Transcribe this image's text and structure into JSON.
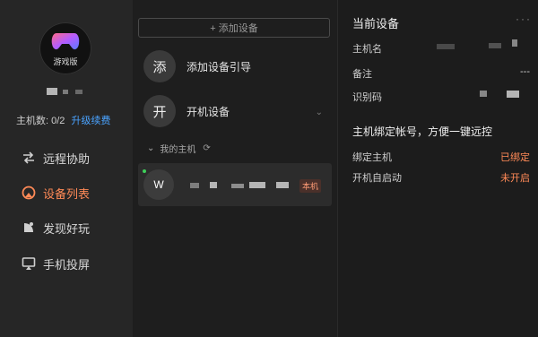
{
  "sidebar": {
    "avatar_label": "游戏版",
    "host_count_label": "主机数: 0/2",
    "upgrade_label": "升级续费",
    "items": [
      {
        "label": "远程协助",
        "icon": "arrows-swap-icon"
      },
      {
        "label": "设备列表",
        "icon": "device-list-icon"
      },
      {
        "label": "发现好玩",
        "icon": "discover-icon"
      },
      {
        "label": "手机投屏",
        "icon": "screen-cast-icon"
      }
    ]
  },
  "device_list": {
    "add_button": "+ 添加设备",
    "actions": [
      {
        "badge": "添",
        "label": "添加设备引导"
      },
      {
        "badge": "开",
        "label": "开机设备"
      }
    ],
    "group_label": "我的主机",
    "host": {
      "initial": "W",
      "badge": "本机"
    }
  },
  "detail": {
    "title": "当前设备",
    "fields": [
      {
        "label": "主机名",
        "value": ""
      },
      {
        "label": "备注",
        "value": "---"
      },
      {
        "label": "识别码",
        "value": ""
      }
    ],
    "section_title": "主机绑定帐号，方便一键远控",
    "statuses": [
      {
        "label": "绑定主机",
        "value": "已绑定"
      },
      {
        "label": "开机自启动",
        "value": "未开启"
      }
    ]
  },
  "colors": {
    "accent": "#ff8a57",
    "link": "#4aa3ff"
  }
}
